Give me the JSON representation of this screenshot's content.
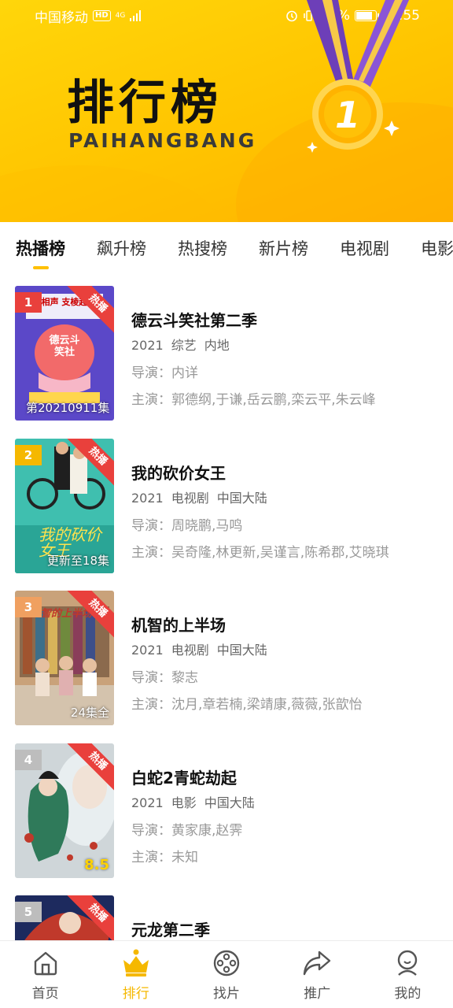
{
  "status_bar": {
    "carrier": "中国移动",
    "hd": "HD",
    "network": "4G",
    "battery": "83%",
    "battery_level": 0.83,
    "time": "11:55"
  },
  "header": {
    "title": "排行榜",
    "subtitle": "PAIHANGBANG",
    "medal_number": "1",
    "colors": {
      "background": "#ffd000",
      "ribbon": "#6d3fb8",
      "medal": "#ffc107"
    }
  },
  "tabs": [
    {
      "label": "热播榜",
      "active": true
    },
    {
      "label": "飙升榜",
      "active": false
    },
    {
      "label": "热搜榜",
      "active": false
    },
    {
      "label": "新片榜",
      "active": false
    },
    {
      "label": "电视剧",
      "active": false
    },
    {
      "label": "电影",
      "active": false
    }
  ],
  "items": [
    {
      "rank": "1",
      "badge": "热播",
      "title": "德云斗笑社第二季",
      "year": "2021",
      "genre": "综艺",
      "region": "内地",
      "director": "导演：内详",
      "cast": "主演：郭德纲,于谦,岳云鹏,栾云平,朱云峰",
      "episode": "第20210911集",
      "rank_color": "#e9403c",
      "poster_text": "德云斗笑社",
      "poster_tagline": "让相声 支棱起来"
    },
    {
      "rank": "2",
      "badge": "热播",
      "title": "我的砍价女王",
      "year": "2021",
      "genre": "电视剧",
      "region": "中国大陆",
      "director": "导演：周晓鹏,马鸣",
      "cast": "主演：吴奇隆,林更新,吴谨言,陈希郡,艾晓琪",
      "episode": "更新至18集",
      "rank_color": "#f5b800",
      "poster_text": "我的砍价女王"
    },
    {
      "rank": "3",
      "badge": "热播",
      "title": "机智的上半场",
      "year": "2021",
      "genre": "电视剧",
      "region": "中国大陆",
      "director": "导演：黎志",
      "cast": "主演：沈月,章若楠,梁靖康,薇薇,张歆怡",
      "episode": "24集全",
      "rank_color": "#f0a060",
      "poster_text": "机智的上半场"
    },
    {
      "rank": "4",
      "badge": "热播",
      "title": "白蛇2青蛇劫起",
      "year": "2021",
      "genre": "电影",
      "region": "中国大陆",
      "director": "导演：黄家康,赵霁",
      "cast": "主演：未知",
      "score": "8.5",
      "rank_color": "#bdbdbd"
    },
    {
      "rank": "5",
      "badge": "热播",
      "title": "元龙第二季",
      "rank_color": "#bdbdbd"
    }
  ],
  "bottom_nav": [
    {
      "label": "首页",
      "icon": "home-icon",
      "active": false
    },
    {
      "label": "排行",
      "icon": "crown-icon",
      "active": true
    },
    {
      "label": "找片",
      "icon": "film-reel-icon",
      "active": false
    },
    {
      "label": "推广",
      "icon": "share-icon",
      "active": false
    },
    {
      "label": "我的",
      "icon": "user-icon",
      "active": false
    }
  ]
}
